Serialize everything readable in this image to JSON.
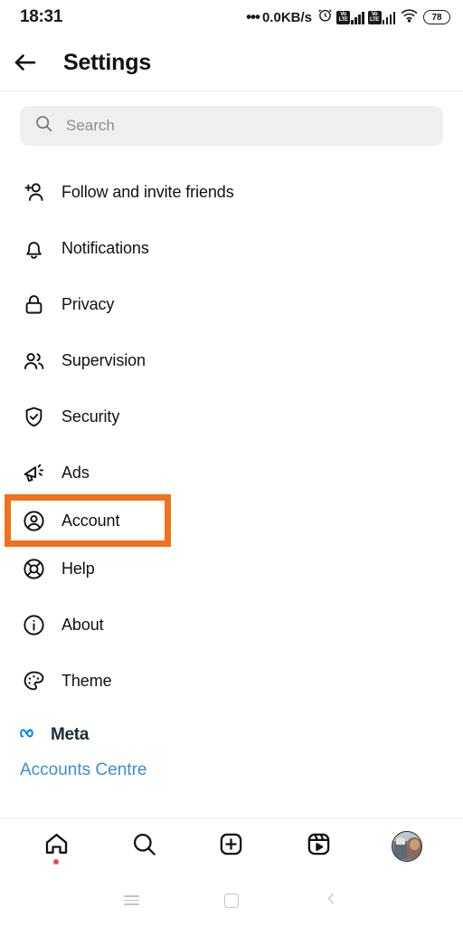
{
  "status_bar": {
    "time": "18:31",
    "dots": "•••",
    "network_speed": "0.0KB/s",
    "alarm_icon": "alarm-clock-icon",
    "volte_label_1": "Vo",
    "volte_label_2": "LTE",
    "wifi_icon": "wifi-icon",
    "battery_level": "78"
  },
  "header": {
    "back_label": "back-arrow",
    "title": "Settings"
  },
  "search": {
    "placeholder": "Search",
    "value": "",
    "icon": "search-icon"
  },
  "menu": {
    "items": [
      {
        "label": "Follow and invite friends",
        "icon": "person-add-icon",
        "highlighted": false
      },
      {
        "label": "Notifications",
        "icon": "bell-icon",
        "highlighted": false
      },
      {
        "label": "Privacy",
        "icon": "lock-icon",
        "highlighted": false
      },
      {
        "label": "Supervision",
        "icon": "people-icon",
        "highlighted": false
      },
      {
        "label": "Security",
        "icon": "shield-check-icon",
        "highlighted": false
      },
      {
        "label": "Ads",
        "icon": "megaphone-icon",
        "highlighted": false
      },
      {
        "label": "Account",
        "icon": "account-circle-icon",
        "highlighted": true
      },
      {
        "label": "Help",
        "icon": "lifebuoy-icon",
        "highlighted": false
      },
      {
        "label": "About",
        "icon": "info-circle-icon",
        "highlighted": false
      },
      {
        "label": "Theme",
        "icon": "palette-icon",
        "highlighted": false
      }
    ]
  },
  "footer": {
    "meta_label": "Meta",
    "meta_logo": "meta-infinity-icon",
    "accounts_centre_label": "Accounts Centre"
  },
  "bottom_nav": {
    "tabs": [
      {
        "name": "home-tab",
        "icon": "home-icon",
        "badge": true
      },
      {
        "name": "search-tab",
        "icon": "search-icon",
        "badge": false
      },
      {
        "name": "create-tab",
        "icon": "plus-square-icon",
        "badge": false
      },
      {
        "name": "reels-tab",
        "icon": "reels-icon",
        "badge": false
      },
      {
        "name": "profile-tab",
        "icon": "avatar-icon",
        "badge": false
      }
    ]
  },
  "android_nav": {
    "recents_label": "recents-icon",
    "home_label": "home-square-icon",
    "back_label": "back-chevron-icon"
  },
  "colors": {
    "highlight_orange": "#f2711c",
    "link_blue": "#3a8fd0",
    "meta_blue": "#0082fb",
    "badge_red": "#ed4956",
    "search_bg": "#efefef"
  }
}
